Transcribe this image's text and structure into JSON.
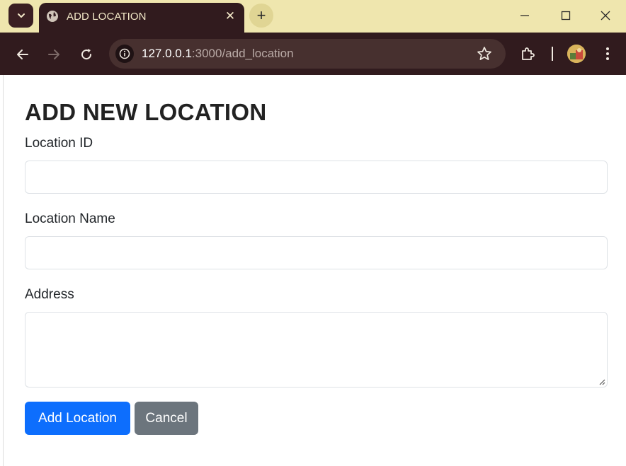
{
  "browser": {
    "tab_title": "ADD LOCATION",
    "tab_close": "✕",
    "new_tab": "+",
    "url_host": "127.0.0.1",
    "url_path": ":3000/add_location",
    "icons": [
      "tab-search-icon",
      "globe-icon",
      "back-icon",
      "forward-icon",
      "reload-icon",
      "info-icon",
      "star-icon",
      "extensions-icon",
      "profile-avatar",
      "menu-icon",
      "minimize-icon",
      "maximize-icon",
      "close-icon"
    ]
  },
  "form": {
    "title": "ADD NEW LOCATION",
    "location_id_label": "Location ID",
    "location_id_value": "",
    "location_name_label": "Location Name",
    "location_name_value": "",
    "address_label": "Address",
    "address_value": "",
    "submit_label": "Add Location",
    "cancel_label": "Cancel"
  },
  "colors": {
    "tabbar_bg": "#efe6ae",
    "toolbar_bg": "#311b1e",
    "primary": "#0d6efd",
    "secondary": "#6c757d"
  }
}
